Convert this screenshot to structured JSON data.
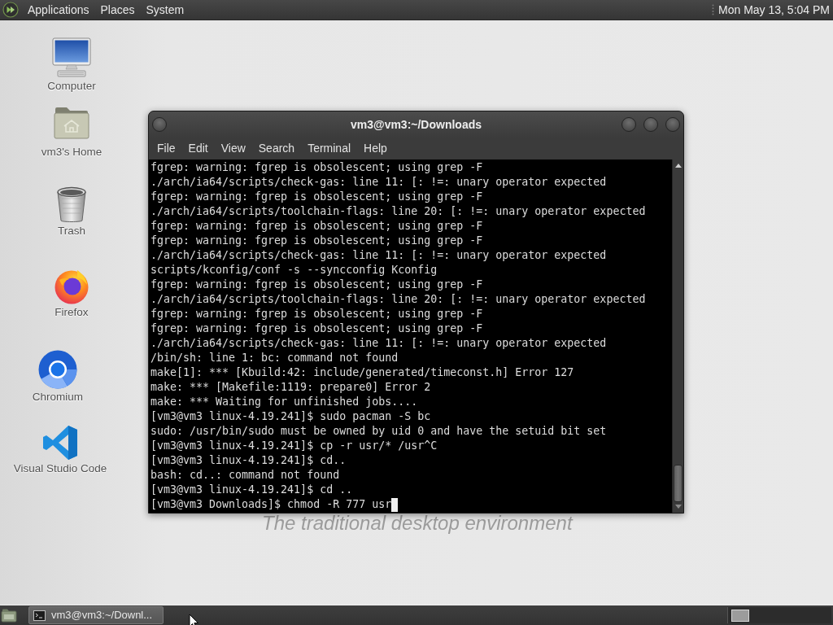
{
  "top_panel": {
    "menus": [
      "Applications",
      "Places",
      "System"
    ],
    "clock": "Mon May 13, 5:04 PM"
  },
  "desktop": {
    "icons": [
      {
        "kind": "computer",
        "label": "Computer"
      },
      {
        "kind": "home",
        "label": "vm3's Home"
      },
      {
        "kind": "trash",
        "label": "Trash"
      },
      {
        "kind": "firefox",
        "label": "Firefox"
      },
      {
        "kind": "chromium",
        "label": "Chromium"
      },
      {
        "kind": "vscode",
        "label": "Visual Studio Code"
      }
    ],
    "wallpaper_text": "The traditional desktop environment"
  },
  "terminal": {
    "title": "vm3@vm3:~/Downloads",
    "menu": [
      "File",
      "Edit",
      "View",
      "Search",
      "Terminal",
      "Help"
    ],
    "lines": [
      "fgrep: warning: fgrep is obsolescent; using grep -F",
      "./arch/ia64/scripts/check-gas: line 11: [: !=: unary operator expected",
      "fgrep: warning: fgrep is obsolescent; using grep -F",
      "./arch/ia64/scripts/toolchain-flags: line 20: [: !=: unary operator expected",
      "fgrep: warning: fgrep is obsolescent; using grep -F",
      "fgrep: warning: fgrep is obsolescent; using grep -F",
      "./arch/ia64/scripts/check-gas: line 11: [: !=: unary operator expected",
      "scripts/kconfig/conf -s --syncconfig Kconfig",
      "fgrep: warning: fgrep is obsolescent; using grep -F",
      "./arch/ia64/scripts/toolchain-flags: line 20: [: !=: unary operator expected",
      "fgrep: warning: fgrep is obsolescent; using grep -F",
      "fgrep: warning: fgrep is obsolescent; using grep -F",
      "./arch/ia64/scripts/check-gas: line 11: [: !=: unary operator expected",
      "/bin/sh: line 1: bc: command not found",
      "make[1]: *** [Kbuild:42: include/generated/timeconst.h] Error 127",
      "make: *** [Makefile:1119: prepare0] Error 2",
      "make: *** Waiting for unfinished jobs....",
      "[vm3@vm3 linux-4.19.241]$ sudo pacman -S bc",
      "sudo: /usr/bin/sudo must be owned by uid 0 and have the setuid bit set",
      "[vm3@vm3 linux-4.19.241]$ cp -r usr/* /usr^C",
      "[vm3@vm3 linux-4.19.241]$ cd..",
      "bash: cd..: command not found",
      "[vm3@vm3 linux-4.19.241]$ cd ..",
      "[vm3@vm3 Downloads]$ chmod -R 777 usr"
    ]
  },
  "taskbar": {
    "tasks": [
      {
        "label": "vm3@vm3:~/Downl...",
        "selected": true
      }
    ]
  }
}
